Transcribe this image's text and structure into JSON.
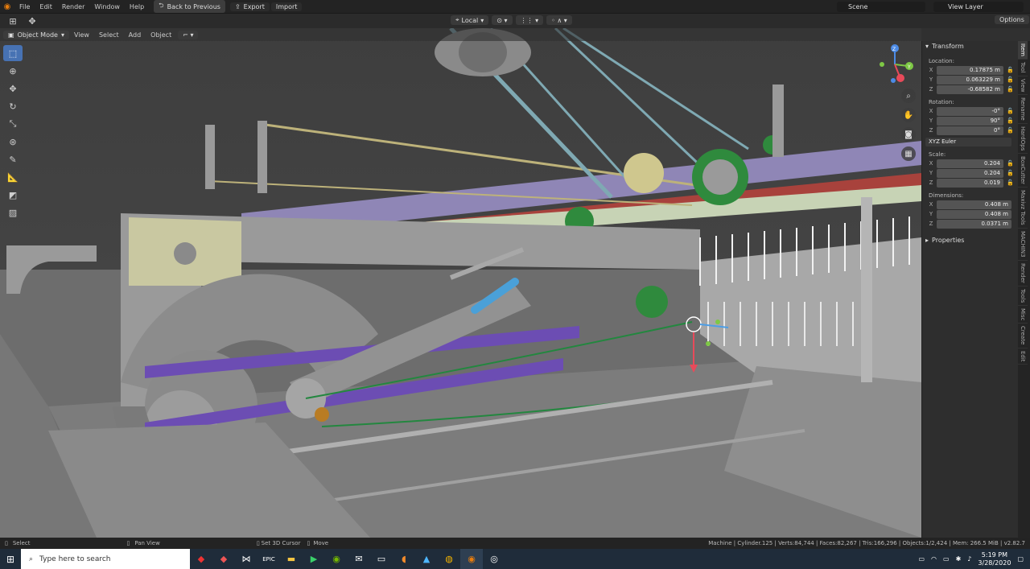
{
  "topbar": {
    "menus": [
      "File",
      "Edit",
      "Render",
      "Window",
      "Help"
    ],
    "back_label": "Back to Previous",
    "export_label": "Export",
    "import_label": "Import",
    "scene": "Scene",
    "view_layer": "View Layer"
  },
  "header": {
    "transform_orientation": "Local",
    "options_label": "Options",
    "mode": "Object Mode",
    "menus": [
      "View",
      "Select",
      "Add",
      "Object"
    ]
  },
  "npanel": {
    "transform_title": "Transform",
    "location_label": "Location:",
    "location": [
      {
        "axis": "X",
        "value": "0.17875 m"
      },
      {
        "axis": "Y",
        "value": "0.063229 m"
      },
      {
        "axis": "Z",
        "value": "-0.68582 m"
      }
    ],
    "rotation_label": "Rotation:",
    "rotation": [
      {
        "axis": "X",
        "value": "-0°"
      },
      {
        "axis": "Y",
        "value": "90°"
      },
      {
        "axis": "Z",
        "value": "0°"
      }
    ],
    "rotation_mode": "XYZ Euler",
    "scale_label": "Scale:",
    "scale": [
      {
        "axis": "X",
        "value": "0.204"
      },
      {
        "axis": "Y",
        "value": "0.204"
      },
      {
        "axis": "Z",
        "value": "0.019"
      }
    ],
    "dimensions_label": "Dimensions:",
    "dimensions": [
      {
        "axis": "X",
        "value": "0.408 m"
      },
      {
        "axis": "Y",
        "value": "0.408 m"
      },
      {
        "axis": "Z",
        "value": "0.0371 m"
      }
    ],
    "properties_title": "Properties",
    "tabs": [
      "Item",
      "Tool",
      "View",
      "Rename",
      "HardOps",
      "BoxCutter",
      "Maxivz Tools",
      "MACHIN3",
      "Render",
      "Tools",
      "Misc",
      "Create",
      "Edit"
    ]
  },
  "statusbar": {
    "select": "Select",
    "pan": "Pan View",
    "cursor": "Set 3D Cursor",
    "move": "Move",
    "stats": "Machine | Cylinder.125 | Verts:84,744 | Faces:82,267 | Tris:166,296 | Objects:1/2,424 | Mem: 266.5 MiB | v2.82.7"
  },
  "taskbar": {
    "search_placeholder": "Type here to search",
    "time": "5:19 PM",
    "date": "3/28/2020"
  }
}
